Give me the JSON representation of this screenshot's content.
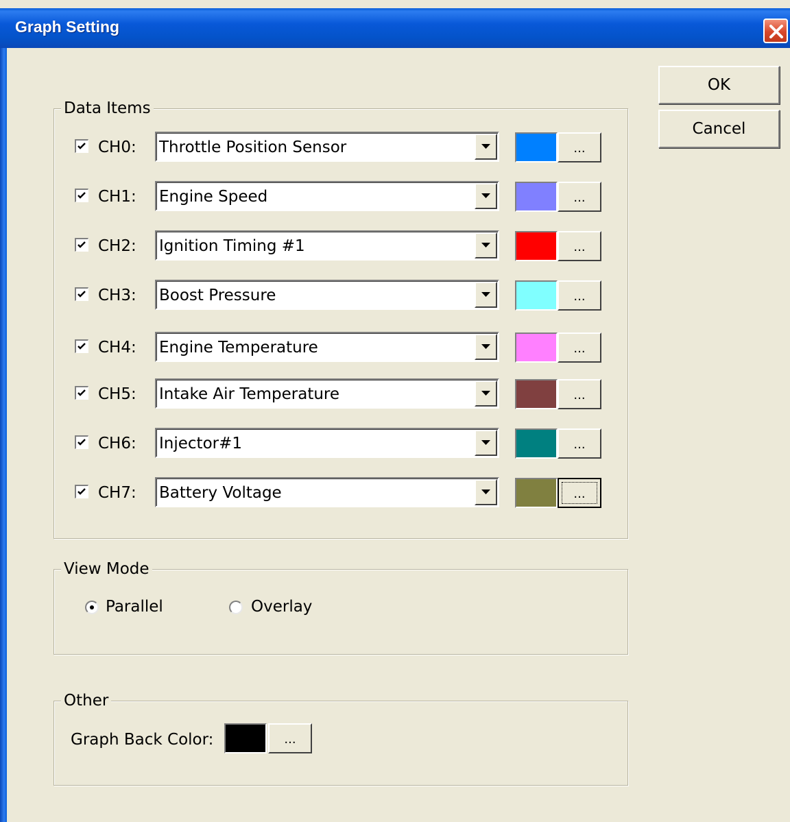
{
  "window": {
    "title": "Graph Setting"
  },
  "buttons": {
    "ok": "OK",
    "cancel": "Cancel"
  },
  "data_items": {
    "label": "Data Items",
    "rows": [
      {
        "channel": "CH0:",
        "checked": true,
        "item": "Throttle Position Sensor",
        "color": "#0080ff",
        "browse": "..."
      },
      {
        "channel": "CH1:",
        "checked": true,
        "item": "Engine Speed",
        "color": "#8080ff",
        "browse": "..."
      },
      {
        "channel": "CH2:",
        "checked": true,
        "item": "Ignition Timing #1",
        "color": "#ff0000",
        "browse": "..."
      },
      {
        "channel": "CH3:",
        "checked": true,
        "item": "Boost Pressure",
        "color": "#80ffff",
        "browse": "..."
      },
      {
        "channel": "CH4:",
        "checked": true,
        "item": "Engine Temperature",
        "color": "#ff80ff",
        "browse": "..."
      },
      {
        "channel": "CH5:",
        "checked": true,
        "item": "Intake Air Temperature",
        "color": "#804040",
        "browse": "..."
      },
      {
        "channel": "CH6:",
        "checked": true,
        "item": "Injector#1",
        "color": "#008080",
        "browse": "..."
      },
      {
        "channel": "CH7:",
        "checked": true,
        "item": "Battery Voltage",
        "color": "#808040",
        "browse": "..."
      }
    ]
  },
  "view_mode": {
    "label": "View Mode",
    "options": [
      {
        "label": "Parallel",
        "selected": true
      },
      {
        "label": "Overlay",
        "selected": false
      }
    ]
  },
  "other": {
    "label": "Other",
    "back_color_label": "Graph Back Color:",
    "back_color": "#000000",
    "browse": "..."
  }
}
